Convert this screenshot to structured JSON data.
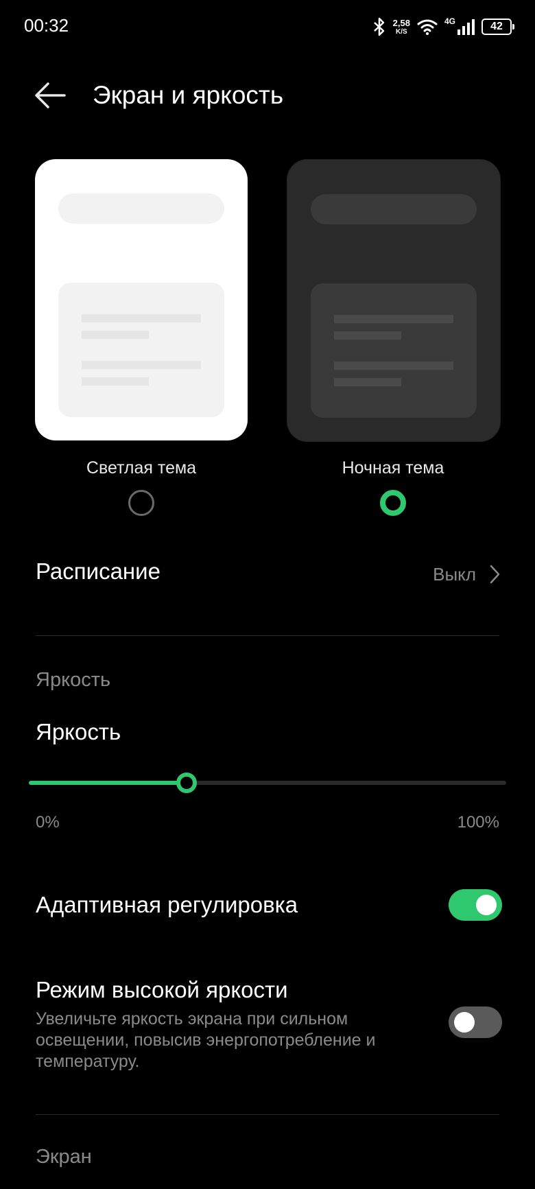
{
  "status_bar": {
    "time": "00:32",
    "speed_value": "2,58",
    "speed_unit": "K/S",
    "network": "4G",
    "battery": "42",
    "icons": [
      "bluetooth-icon",
      "wifi-icon",
      "signal-icon",
      "battery-icon"
    ]
  },
  "header": {
    "title": "Экран и яркость",
    "back_icon": "arrow-left-icon"
  },
  "themes": {
    "light_label": "Светлая тема",
    "dark_label": "Ночная тема",
    "selected": "dark"
  },
  "schedule": {
    "label": "Расписание",
    "value": "Выкл"
  },
  "brightness_section": {
    "header": "Яркость",
    "label": "Яркость",
    "min_label": "0%",
    "max_label": "100%",
    "level_fraction": 0.33
  },
  "adaptive": {
    "label": "Адаптивная регулировка",
    "enabled": true
  },
  "high_brightness": {
    "label": "Режим высокой яркости",
    "description": "Увеличьте яркость экрана при сильном освещении, повысив энергопотребление и температуру.",
    "enabled": false
  },
  "screen_section": {
    "header": "Экран"
  },
  "colors": {
    "accent": "#2fc86e",
    "background": "#000000",
    "secondary_text": "#8a8a8a"
  }
}
